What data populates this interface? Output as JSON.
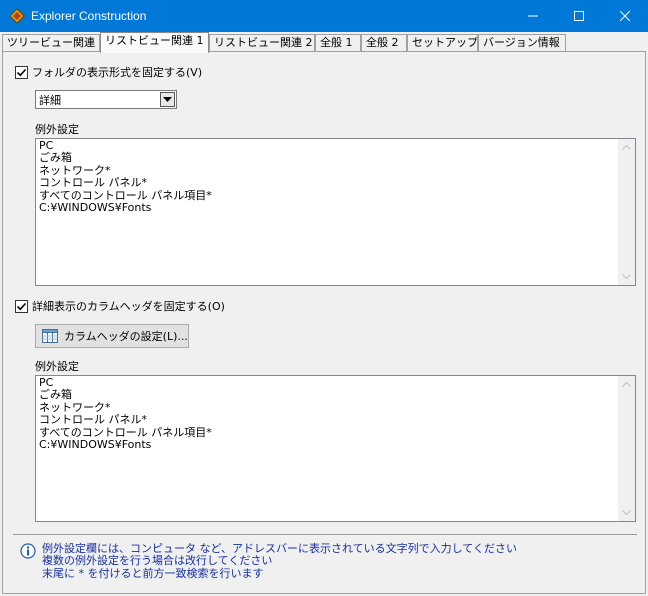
{
  "window": {
    "title": "Explorer Construction"
  },
  "tabs": [
    "ツリービュー関連",
    "リストビュー関連 1",
    "リストビュー関連 2",
    "全般 1",
    "全般 2",
    "セットアップ",
    "バージョン情報"
  ],
  "section1": {
    "checkbox_label": "フォルダの表示形式を固定する(V)",
    "checked": true,
    "view_select": "詳細",
    "exceptions_label": "例外設定",
    "exceptions": [
      "PC",
      "ごみ箱",
      "ネットワーク*",
      "コントロール パネル*",
      "すべてのコントロール パネル項目*",
      "C:¥WINDOWS¥Fonts"
    ]
  },
  "section2": {
    "checkbox_label": "詳細表示のカラムヘッダを固定する(O)",
    "checked": true,
    "button_label": "カラムヘッダの設定(L)...",
    "exceptions_label": "例外設定",
    "exceptions": [
      "PC",
      "ごみ箱",
      "ネットワーク*",
      "コントロール パネル*",
      "すべてのコントロール パネル項目*",
      "C:¥WINDOWS¥Fonts"
    ]
  },
  "notes": [
    "例外設定欄には、コンピュータ など、アドレスバーに表示されている文字列で入力してください",
    "複数の例外設定を行う場合は改行してください",
    "末尾に * を付けると前方一致検索を行います"
  ],
  "icons": {
    "app": "app-diamond-icon",
    "minimize": "minimize-icon",
    "maximize": "maximize-icon",
    "close": "close-icon",
    "info": "info-icon",
    "column_settings": "column-table-icon"
  }
}
